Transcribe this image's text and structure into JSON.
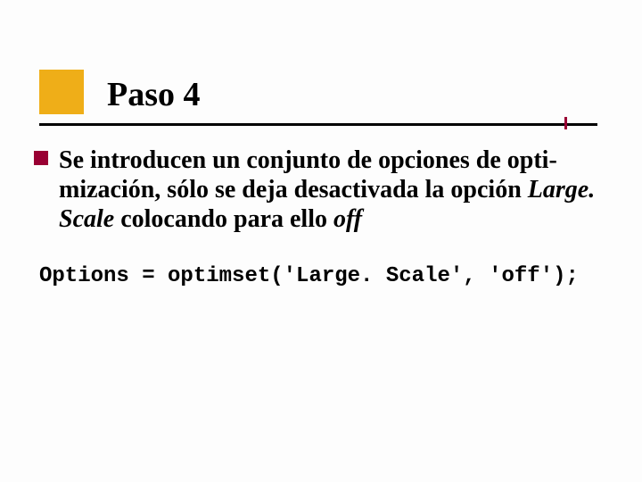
{
  "title": "Paso 4",
  "paragraph": {
    "part1": "Se introducen un conjunto de opciones de opti-mización, sólo se deja desactivada la opción ",
    "largescale": "Large. Scale",
    "part2": " colocando para ello ",
    "off": "off"
  },
  "code": "Options = optimset('Large. Scale', 'off');"
}
